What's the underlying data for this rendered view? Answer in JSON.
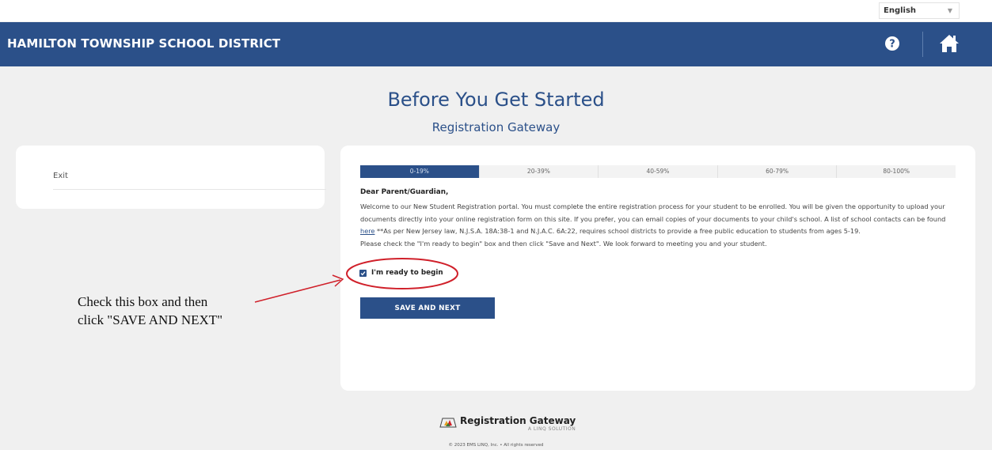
{
  "language": {
    "selected": "English"
  },
  "header": {
    "title": "HAMILTON TOWNSHIP SCHOOL DISTRICT",
    "help_icon": "question-circle-icon",
    "home_icon": "home-icon"
  },
  "page": {
    "title": "Before You Get Started",
    "subtitle": "Registration Gateway"
  },
  "sidebar": {
    "exit_label": "Exit"
  },
  "progress": {
    "segments": [
      "0-19%",
      "20-39%",
      "40-59%",
      "60-79%",
      "80-100%"
    ],
    "active_index": 0
  },
  "content": {
    "greeting": "Dear Parent/Guardian,",
    "intro_part1": "Welcome to our New Student Registration portal.  You must complete the entire registration process for your student to be enrolled.  You will be given the opportunity to upload your documents directly into your online registration form on this site.  If you prefer, you can email copies of your documents to your child's school.  A list of school contacts can be found ",
    "intro_link": "here",
    "intro_part2": "  **As per New Jersey law, N.J.S.A. 18A:38-1 and N.J.A.C. 6A:22, requires school districts to provide a free public education to students from ages 5-19.",
    "instructions": "Please check the \"I'm ready to begin\" box and then click \"Save and Next\". We look forward to meeting you and your student.",
    "ready_label": "I'm ready to begin",
    "ready_checked": true,
    "save_label": "SAVE AND NEXT"
  },
  "annotation": {
    "line1": "Check this box and then",
    "line2": "click \"SAVE AND NEXT\"",
    "color": "#d0202a"
  },
  "footer": {
    "brand": "Registration Gateway",
    "tagline": "A LINQ SOLUTION",
    "copyright": "© 2023 EMS LINQ, Inc. • All rights reserved"
  },
  "colors": {
    "primary": "#2b5089",
    "background": "#f0f0f0"
  }
}
